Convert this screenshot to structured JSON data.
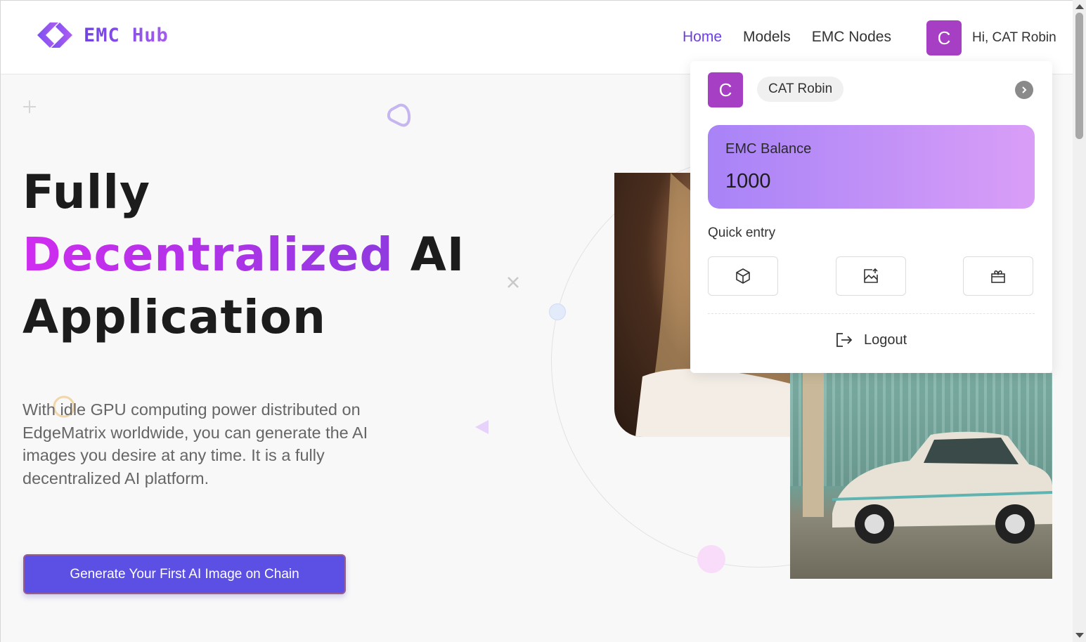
{
  "header": {
    "logo_text": "EMC Hub",
    "nav": [
      {
        "label": "Home",
        "active": true
      },
      {
        "label": "Models",
        "active": false
      },
      {
        "label": "EMC Nodes",
        "active": false
      }
    ],
    "avatar_initial": "C",
    "greeting": "Hi, CAT Robin"
  },
  "hero": {
    "title_line1": "Fully",
    "title_highlight": "Decentralized",
    "title_line2_rest": "AI",
    "title_line3": "Application",
    "description": "With idle GPU computing power distributed on EdgeMatrix worldwide, you can generate the AI images you desire at any time. It is a fully decentralized AI platform.",
    "cta_label": "Generate Your First AI Image on Chain"
  },
  "dropdown": {
    "avatar_initial": "C",
    "username": "CAT Robin",
    "balance_label": "EMC Balance",
    "balance_value": "1000",
    "quick_entry_label": "Quick entry",
    "quick_entry_icons": [
      "cube-icon",
      "image-upload-icon",
      "gift-box-icon"
    ],
    "logout_label": "Logout"
  },
  "colors": {
    "accent": "#6c3fe0",
    "avatar": "#a63fc4",
    "cta": "#5b4fe4",
    "gradient_start": "#d02cf0",
    "gradient_end": "#8f3ae0"
  }
}
